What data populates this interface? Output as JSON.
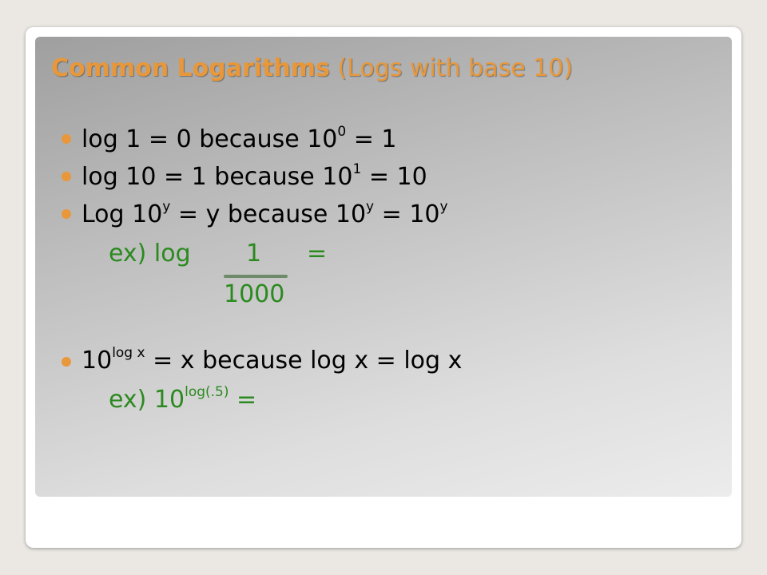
{
  "title": {
    "bold": "Common Logarithms",
    "rest": " (Logs with base 10)"
  },
  "bullets": [
    {
      "pre": "log 1 = 0 because 10",
      "sup": "0",
      "post": " = 1"
    },
    {
      "pre": "log 10 = 1 because 10",
      "sup": "1",
      "post": " = 10"
    },
    {
      "a": "Log 10",
      "asup": "y",
      "b": " = y because 10",
      "bsup": "y",
      "c": " = 10",
      "csup": "y"
    },
    {
      "pre": "10",
      "sup": "log x",
      "post": " = x because log x = log x"
    }
  ],
  "example1": {
    "prefix": "ex) log",
    "numerator": "1",
    "equals": "=",
    "denominator": "1000"
  },
  "example2": {
    "prefix": "ex) 10",
    "sup": "log(.5)",
    "post": " ="
  },
  "colors": {
    "accent": "#e8983a",
    "example_green": "#2b8a1f"
  }
}
